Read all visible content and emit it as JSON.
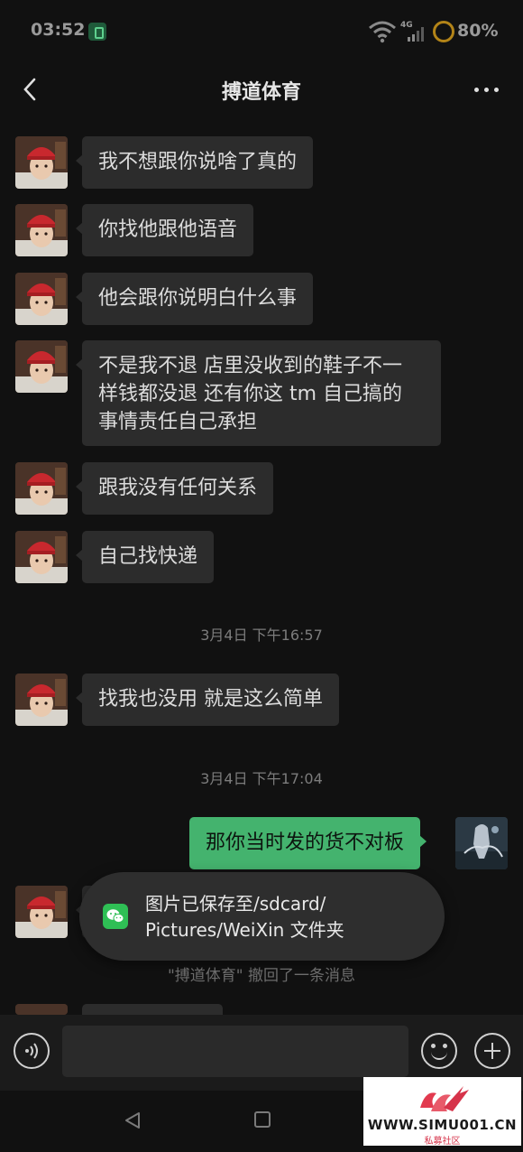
{
  "status_bar": {
    "time": "03:52",
    "network": "4G",
    "battery": "80%"
  },
  "header": {
    "title": "搏道体育"
  },
  "messages": [
    {
      "side": "left",
      "text": "我不想跟你说啥了真的"
    },
    {
      "side": "left",
      "text": "你找他跟他语音"
    },
    {
      "side": "left",
      "text": "他会跟你说明白什么事"
    },
    {
      "side": "left",
      "lines": [
        "不是我不退 店里没收到的鞋子不一",
        "样钱都没退 还有你这 tm 自己搞的",
        "事情责任自己承担"
      ]
    },
    {
      "side": "left",
      "text": "跟我没有任何关系"
    },
    {
      "side": "left",
      "text": "自己找快递"
    },
    {
      "side": "left",
      "text": "找我也没用 就是这么简单"
    },
    {
      "side": "right",
      "text": "那你当时发的货不对板"
    }
  ],
  "timestamps": [
    "3月4日 下午16:57",
    "3月4日 下午17:04"
  ],
  "recall_notice": "\"搏道体育\" 撤回了一条消息",
  "toast": {
    "line1": "图片已保存至/sdcard/",
    "line2": "Pictures/WeiXin 文件夹"
  },
  "watermark": {
    "url": "WWW.SIMU001.CN",
    "subtitle": "私募社区"
  }
}
